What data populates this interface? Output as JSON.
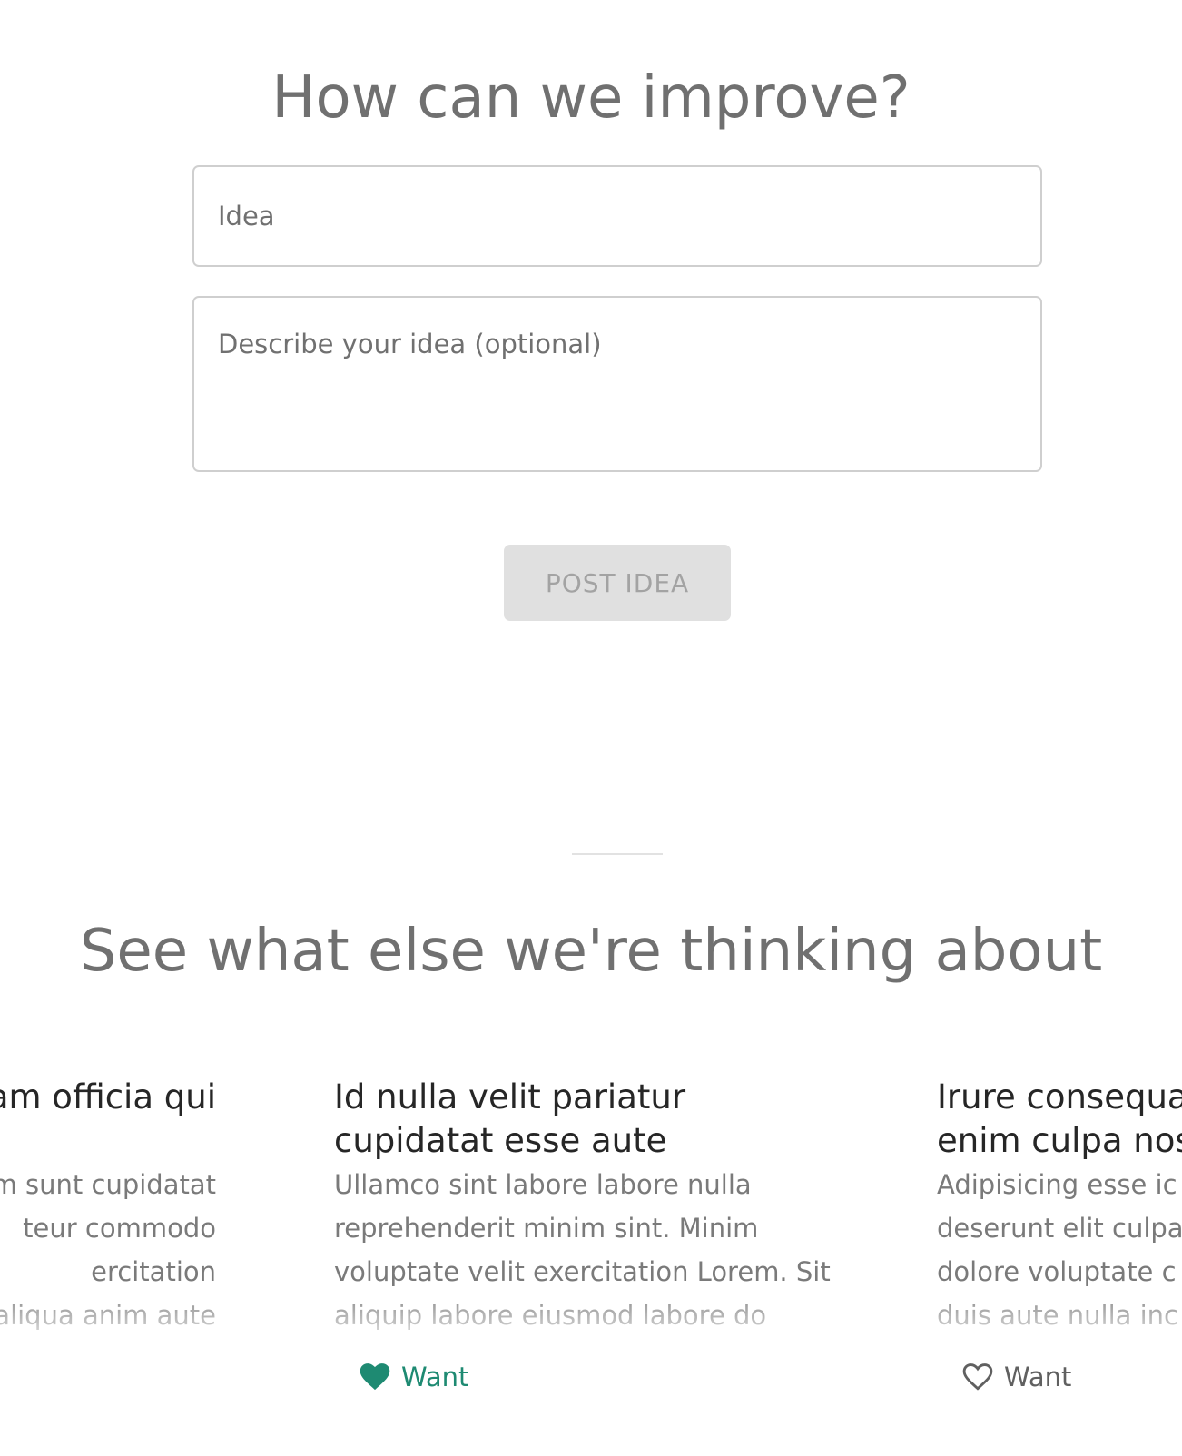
{
  "form": {
    "title": "How can we improve?",
    "idea_placeholder": "Idea",
    "description_placeholder": "Describe your idea (optional)",
    "post_button_label": "POST IDEA"
  },
  "ideas_section": {
    "title": "See what else we're thinking about",
    "cards": [
      {
        "title_lines": [
          "am officia qui",
          ""
        ],
        "body_lines": [
          "m sunt cupidatat",
          "teur commodo",
          "ercitation",
          "aliqua anim aute"
        ],
        "want_label": ""
      },
      {
        "title_lines": [
          "Id nulla velit pariatur",
          "cupidatat esse aute"
        ],
        "body_lines": [
          "Ullamco sint labore labore nulla",
          "reprehenderit minim sint. Minim",
          "voluptate velit exercitation Lorem. Sit",
          "aliquip labore eiusmod labore do"
        ],
        "want_label": "Want",
        "wanted": true
      },
      {
        "title_lines": [
          "Irure consequa",
          "enim culpa nos"
        ],
        "body_lines": [
          "Adipisicing esse ic",
          "deserunt elit culpa",
          "dolore voluptate c",
          "duis aute nulla inc"
        ],
        "want_label": "Want",
        "wanted": false
      }
    ]
  },
  "colors": {
    "accent": "#1e8a72",
    "heading": "#707070",
    "card_title": "#262626",
    "button_bg": "#e0e0e0"
  },
  "icons": {
    "want_active": "heart-filled-icon",
    "want_inactive": "heart-outline-icon"
  }
}
